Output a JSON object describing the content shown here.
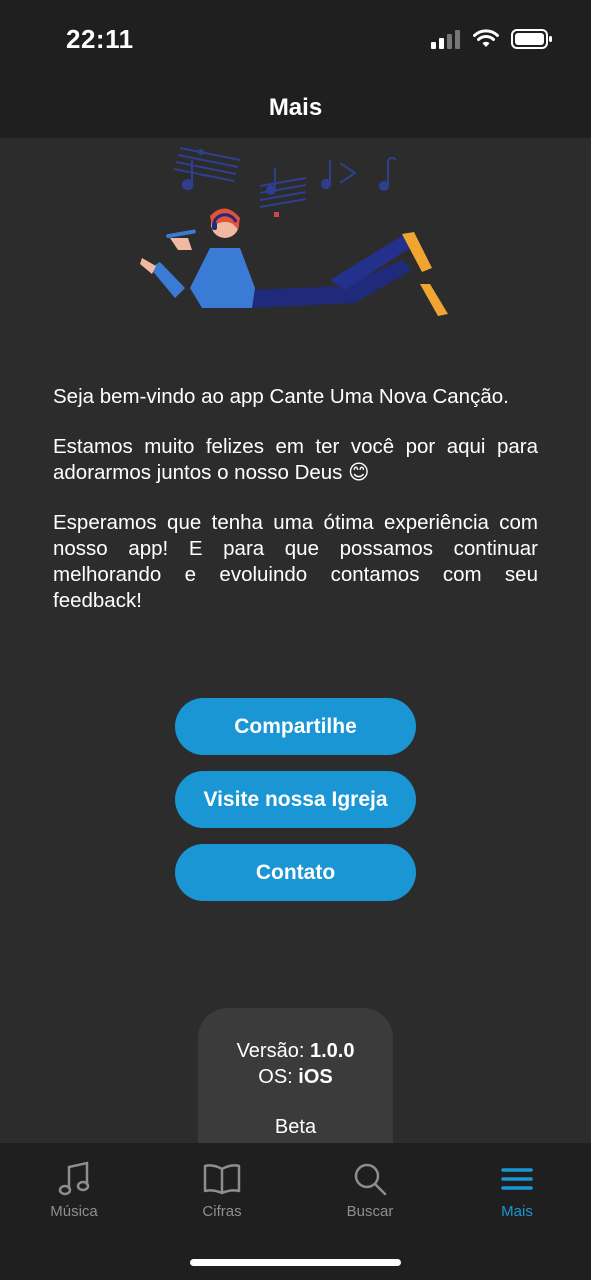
{
  "status_bar": {
    "time": "22:11"
  },
  "nav": {
    "title": "Mais"
  },
  "welcome": {
    "p1": "Seja bem-vindo ao app Cante Uma Nova Canção.",
    "p2": "Estamos muito felizes em ter você por aqui para adorarmos juntos o nosso Deus 😊",
    "p3": "Esperamos que tenha uma ótima experiência com nosso app! E para que possamos continuar melhorando e evoluindo contamos com seu feedback!"
  },
  "buttons": {
    "share": "Compartilhe",
    "church": "Visite nossa Igreja",
    "contact": "Contato"
  },
  "version_card": {
    "version_label": "Versão:",
    "version_value": "1.0.0",
    "os_label": "OS:",
    "os_value": "iOS",
    "beta": "Beta"
  },
  "tabs": [
    {
      "label": "Música",
      "icon": "music-note-icon"
    },
    {
      "label": "Cifras",
      "icon": "book-icon"
    },
    {
      "label": "Buscar",
      "icon": "search-icon"
    },
    {
      "label": "Mais",
      "icon": "menu-icon",
      "active": true
    }
  ],
  "colors": {
    "accent": "#1a96d4",
    "background": "#2c2c2c",
    "bar": "#1f1f1f",
    "card": "#3b3b3b"
  }
}
